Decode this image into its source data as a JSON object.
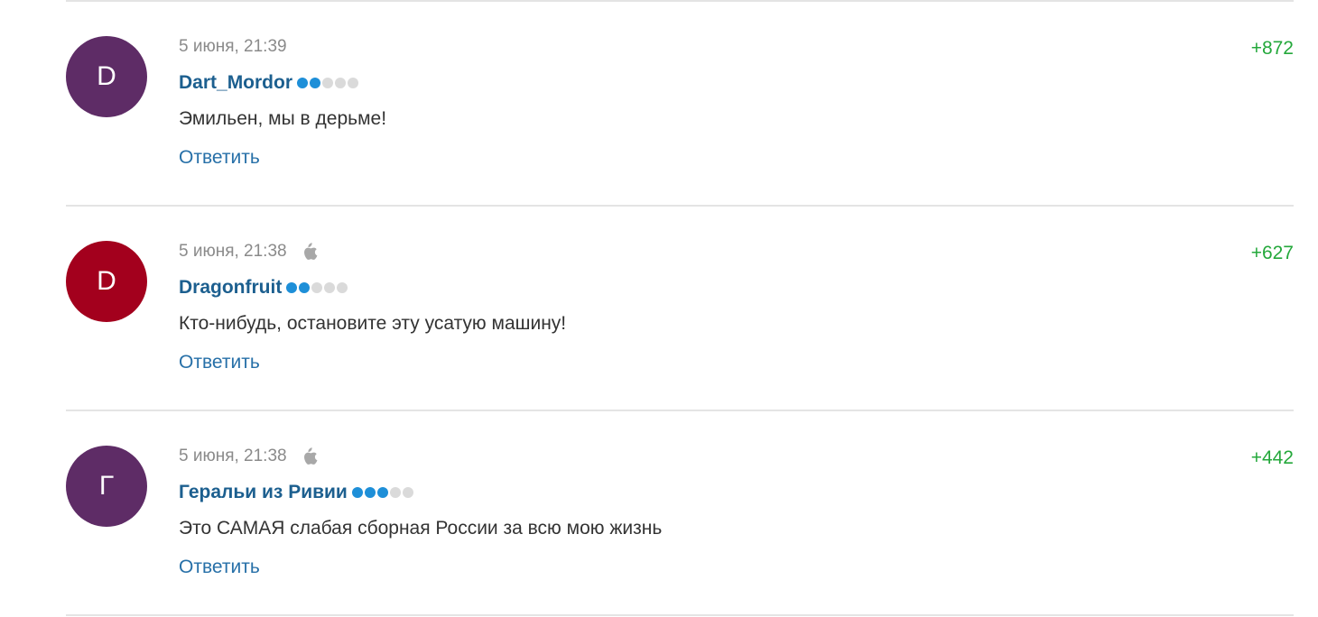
{
  "comments": [
    {
      "avatar_letter": "D",
      "avatar_color": "#5e2c66",
      "date": "5 июня, 21:39",
      "device_icon": "",
      "author": "Dart_Mordor",
      "rating_level": 2,
      "rating_max": 5,
      "text": "Эмильен, мы в дерьме!",
      "reply_label": "Ответить",
      "score": "+872"
    },
    {
      "avatar_letter": "D",
      "avatar_color": "#a3001d",
      "date": "5 июня, 21:38",
      "device_icon": "apple-icon",
      "author": "Dragonfruit",
      "rating_level": 2,
      "rating_max": 5,
      "text": "Кто-нибудь, остановите эту усатую машину!",
      "reply_label": "Ответить",
      "score": "+627"
    },
    {
      "avatar_letter": "Г",
      "avatar_color": "#5e2c66",
      "date": "5 июня, 21:38",
      "device_icon": "apple-icon",
      "author": "Геральи из Ривии",
      "rating_level": 3,
      "rating_max": 5,
      "text": "Это САМАЯ слабая сборная России за всю мою жизнь",
      "reply_label": "Ответить",
      "score": "+442"
    }
  ],
  "colors": {
    "author_link": "#1c5f8f",
    "reply_link": "#2770a8",
    "score_positive": "#24a83b",
    "rating_on": "#1e8fd8",
    "rating_off": "#dadada",
    "divider": "#e4e4e4"
  }
}
